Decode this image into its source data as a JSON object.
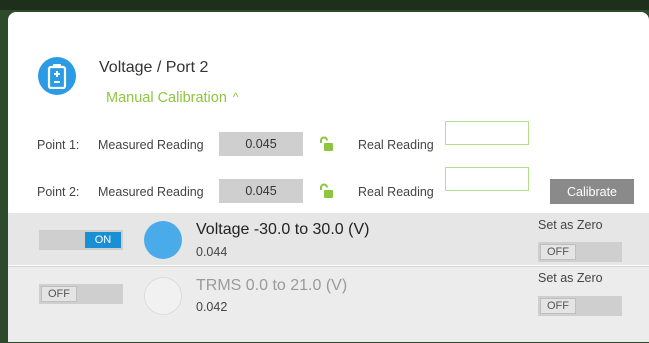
{
  "header": {
    "title": "Voltage / Port 2",
    "manual_calibration": "Manual Calibration",
    "chevron": "^"
  },
  "calibration": {
    "points": [
      {
        "label": "Point 1:",
        "measured_label": "Measured Reading",
        "measured_value": "0.045",
        "real_label": "Real Reading",
        "real_value": ""
      },
      {
        "label": "Point 2:",
        "measured_label": "Measured Reading",
        "measured_value": "0.045",
        "real_label": "Real Reading",
        "real_value": ""
      }
    ],
    "calibrate_label": "Calibrate"
  },
  "sensors": [
    {
      "toggle": "ON",
      "name": "Voltage -30.0 to 30.0 (V)",
      "value": "0.044",
      "zero_label": "Set as Zero",
      "zero_toggle": "OFF",
      "color": "#4aabea"
    },
    {
      "toggle": "OFF",
      "name": "TRMS 0.0 to 21.0 (V)",
      "value": "0.042",
      "zero_label": "Set as Zero",
      "zero_toggle": "OFF",
      "color": "#f1f1f1"
    }
  ],
  "colors": {
    "accent_green": "#8cc63f",
    "accent_blue": "#2c9be6",
    "toggle_on": "#1a8fd4"
  },
  "icons": {
    "sensor": "battery-icon",
    "lock": "unlocked-icon"
  }
}
